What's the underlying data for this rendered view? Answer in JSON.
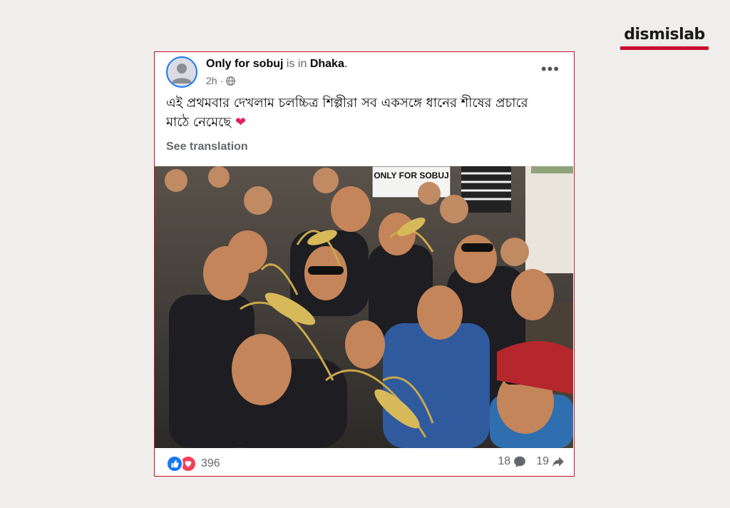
{
  "brand": {
    "name": "dismislab",
    "accent": "#c8102e"
  },
  "post": {
    "author": "Only for sobuj",
    "connector": "is in",
    "location": "Dhaka",
    "time": "2h",
    "time_separator": "·",
    "more_label": "•••",
    "text_line1": "এই প্রথমবার দেখলাম চলচ্চিত্র শিল্পীরা সব একসঙ্গে ধানের শীষের প্রচারে",
    "text_line2": "মাঠে নেমেছে",
    "see_translation": "See translation",
    "photo": {
      "sign_text": "ONLY FOR SOBUJ",
      "description_icon": "group-selfie-photo"
    },
    "reactions_count": "396",
    "comments_count": "18",
    "shares_count": "19"
  },
  "colors": {
    "facebook_blue": "#1877f2",
    "love_red": "#f33e58",
    "muted": "#65676b"
  }
}
